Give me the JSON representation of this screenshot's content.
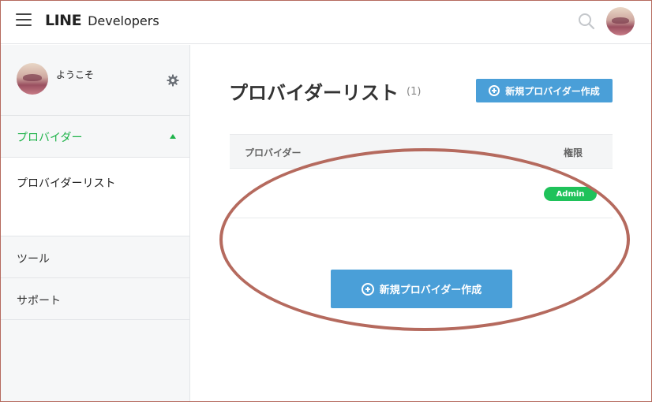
{
  "header": {
    "brand": "LINE",
    "subtitle": "Developers",
    "menu_icon": "hamburger-menu-icon",
    "search_icon": "search-icon",
    "avatar_icon": "user-avatar"
  },
  "sidebar": {
    "welcome": "ようこそ",
    "settings_icon": "gear-icon",
    "section": {
      "label": "プロバイダー",
      "expanded": true,
      "color": "#1fb34a",
      "items": [
        {
          "label": "プロバイダーリスト"
        }
      ]
    },
    "nav": [
      {
        "label": "ツール"
      },
      {
        "label": "サポート"
      }
    ]
  },
  "main": {
    "title": "プロバイダーリスト",
    "count": "(1)",
    "create_button_label": "新規プロバイダー作成",
    "table": {
      "headers": [
        "プロバイダー",
        "権限"
      ],
      "rows": [
        {
          "provider": "",
          "role": "Admin"
        }
      ]
    },
    "center_button_label": "新規プロバイダー作成",
    "accent_color": "#4a9fd8",
    "badge_color": "#1fc25a"
  },
  "annotation": {
    "shape": "ellipse",
    "color": "#b56a5e"
  }
}
